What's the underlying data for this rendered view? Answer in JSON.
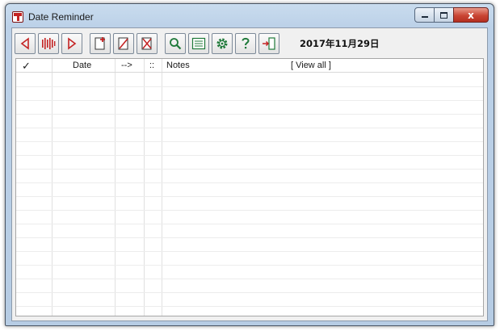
{
  "window": {
    "title": "Date Reminder"
  },
  "caption_buttons": {
    "close_label": "x"
  },
  "toolbar": {
    "date_text": "2017年11月29日",
    "buttons": [
      "previous-day",
      "today",
      "next-day",
      "new-note",
      "edit-note",
      "delete-note",
      "search",
      "list-view",
      "settings",
      "help",
      "exit"
    ]
  },
  "colors": {
    "accent_red": "#c42323",
    "icon_green": "#1f7a3a",
    "title_bar": "#bcd1e8"
  },
  "table": {
    "columns": {
      "check": "✓",
      "date": "Date",
      "arrow": "-->",
      "marker": "::",
      "notes": "Notes",
      "view_all": "[ View all ]"
    },
    "rows": []
  }
}
